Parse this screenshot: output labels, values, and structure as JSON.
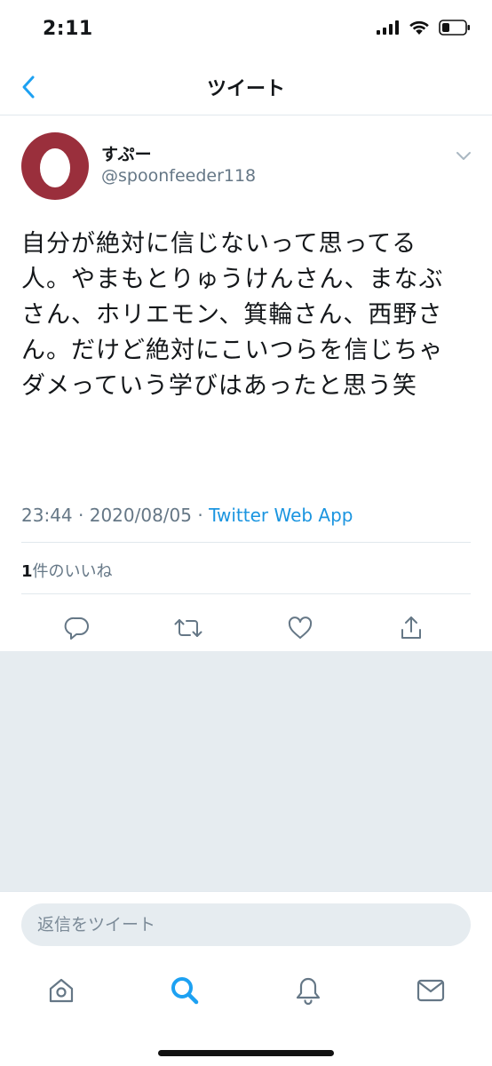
{
  "status_bar": {
    "time": "2:11"
  },
  "nav": {
    "title": "ツイート",
    "back_icon": "chevron-left-icon"
  },
  "tweet": {
    "author_name": "すぷー",
    "author_handle": "@spoonfeeder118",
    "text": "自分が絶対に信じないって思ってる人。やまもとりゅうけんさん、まなぶさん、ホリエモン、箕輪さん、西野さん。だけど絶対にこいつらを信じちゃダメっていう学びはあったと思う笑",
    "time": "23:44",
    "separator": "·",
    "date": "2020/08/05",
    "source": "Twitter Web App",
    "likes_count": "1",
    "likes_label": "件のいいね"
  },
  "actions": [
    "reply-icon",
    "retweet-icon",
    "like-icon",
    "share-icon"
  ],
  "reply": {
    "placeholder": "返信をツイート"
  },
  "tabs": [
    "home-icon",
    "search-icon",
    "notifications-icon",
    "messages-icon"
  ],
  "colors": {
    "accent": "#1da1f2",
    "secondary_text": "#657786",
    "background_gray": "#e6ecf0",
    "avatar_bg": "#9a2f3c"
  }
}
